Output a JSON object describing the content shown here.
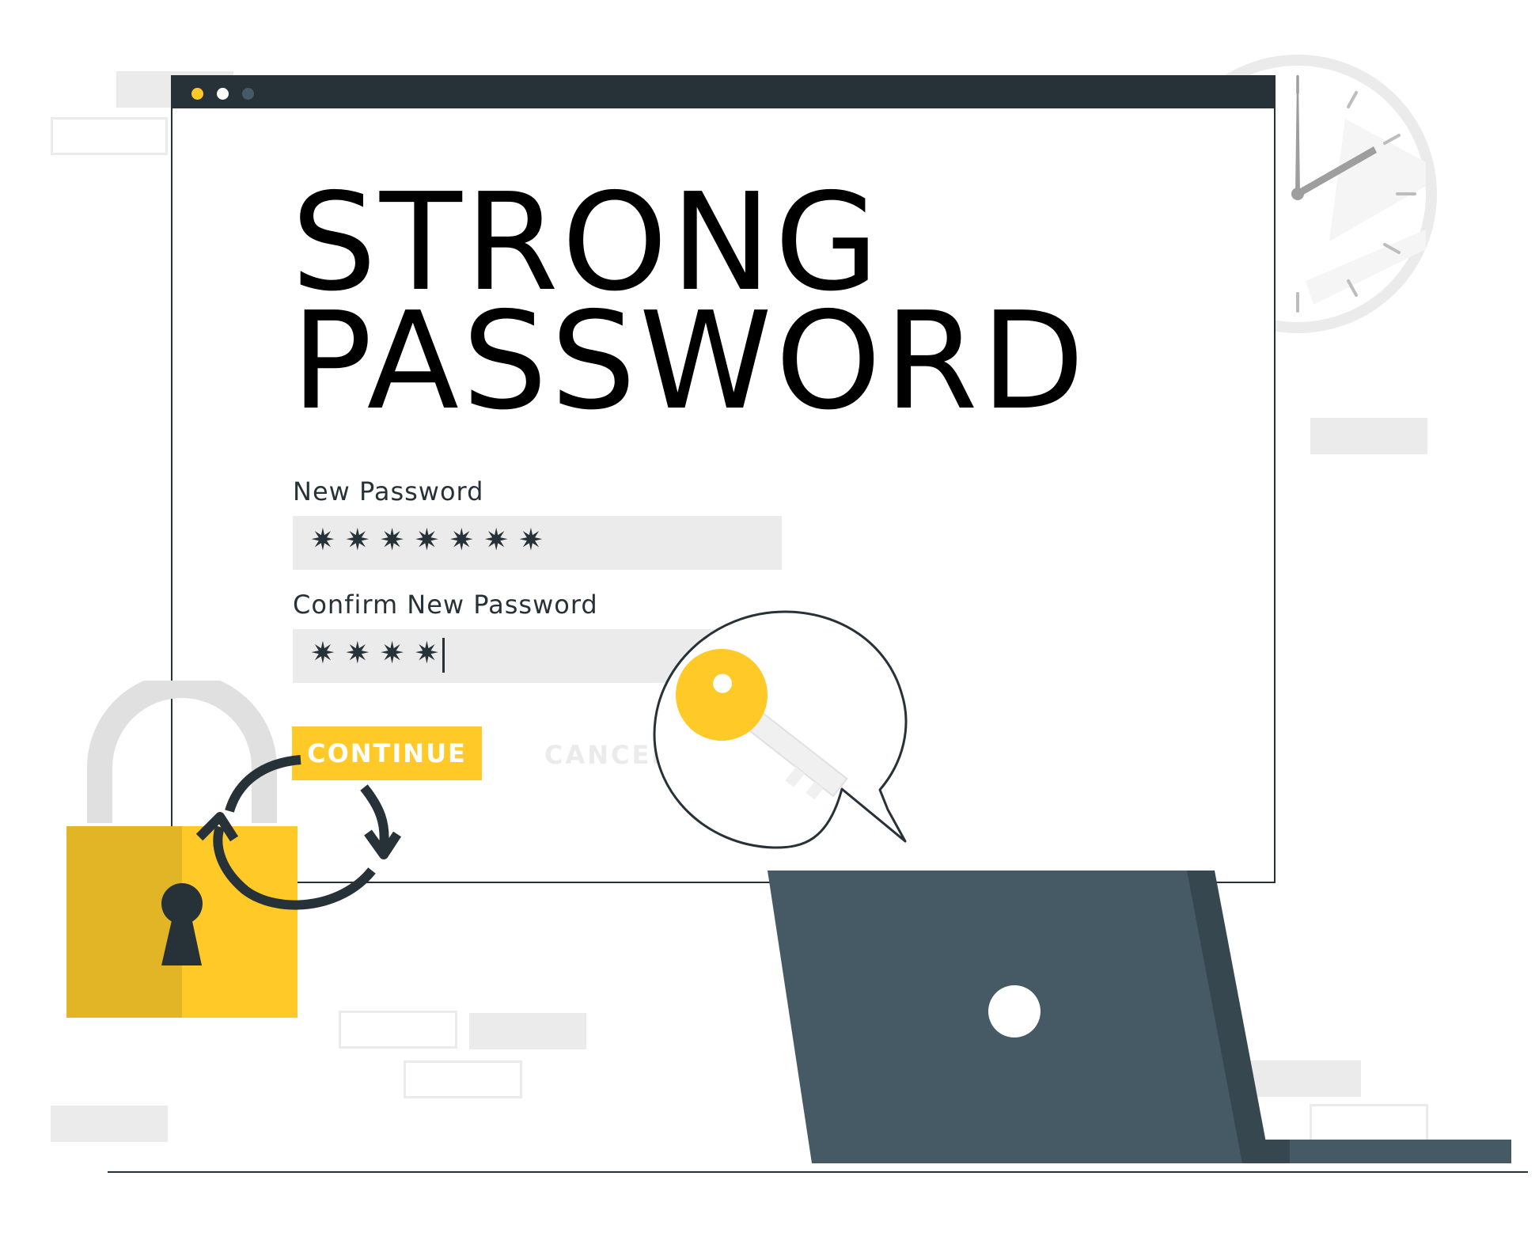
{
  "headline": {
    "line1": "STRONG",
    "line2": "PASSWORD"
  },
  "form": {
    "new_password": {
      "label": "New Password",
      "value": "✷✷✷✷✷✷✷"
    },
    "confirm_password": {
      "label": "Confirm New Password",
      "value": "✷✷✷✷"
    },
    "continue_label": "CONTINUE",
    "cancel_label": "CANCEL"
  },
  "colors": {
    "accent": "#ffca28",
    "dark": "#263238",
    "slate": "#455a64",
    "light_grey": "#ebebeb"
  },
  "icons": [
    "clock-icon",
    "padlock-icon",
    "refresh-arrows-icon",
    "key-icon",
    "speech-bubble-icon",
    "laptop-icon"
  ]
}
